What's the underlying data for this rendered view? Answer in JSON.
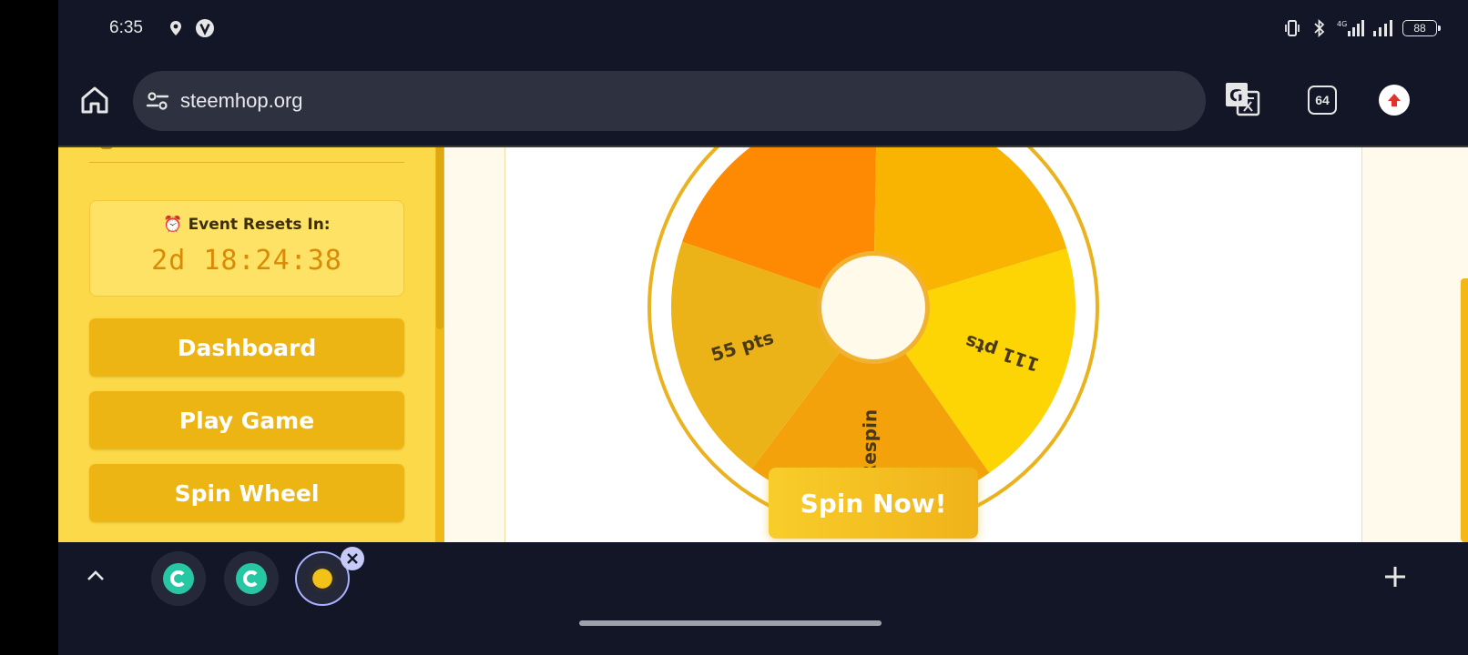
{
  "status_bar": {
    "time": "6:35",
    "left_icons": [
      "location-pin-icon",
      "vpn-v-icon"
    ],
    "right_icons": [
      "vibrate-icon",
      "bluetooth-icon",
      "signal-4g-icon",
      "signal-icon"
    ],
    "network_label": "4G",
    "battery": "88"
  },
  "browser": {
    "url": "steemhop.org",
    "tab_count": "64",
    "icons": [
      "home-icon",
      "site-info-icon",
      "translate-icon",
      "upload-icon"
    ]
  },
  "sidebar": {
    "event_icon": "⏰",
    "event_label": "Event Resets In:",
    "countdown": "2d 18:24:38",
    "nav": [
      {
        "label": "Dashboard"
      },
      {
        "label": "Play Game"
      },
      {
        "label": "Spin Wheel"
      }
    ]
  },
  "wheel": {
    "segments": [
      {
        "label": "111 pts",
        "color": "#fdd505"
      },
      {
        "label": "Respin",
        "color": "#f3a20b"
      },
      {
        "label": "55 pts",
        "color": "#ebb318"
      },
      {
        "label": "",
        "color": "#fe8a04"
      },
      {
        "label": "",
        "color": "#f8b400"
      }
    ],
    "rim_color": "#e9b21e",
    "hub_color": "#fffaea"
  },
  "spin_button": {
    "label": "Spin Now!"
  },
  "tab_strip": {
    "tabs": [
      {
        "favicon": "teal-circle-favicon"
      },
      {
        "favicon": "teal-circle-favicon"
      },
      {
        "favicon": "steemhop-favicon",
        "active": true
      }
    ]
  },
  "colors": {
    "accent": "#ecb513",
    "sidebar_bg": "#fbd949",
    "countdown": "#d98a06",
    "browser_chrome": "#121626"
  }
}
